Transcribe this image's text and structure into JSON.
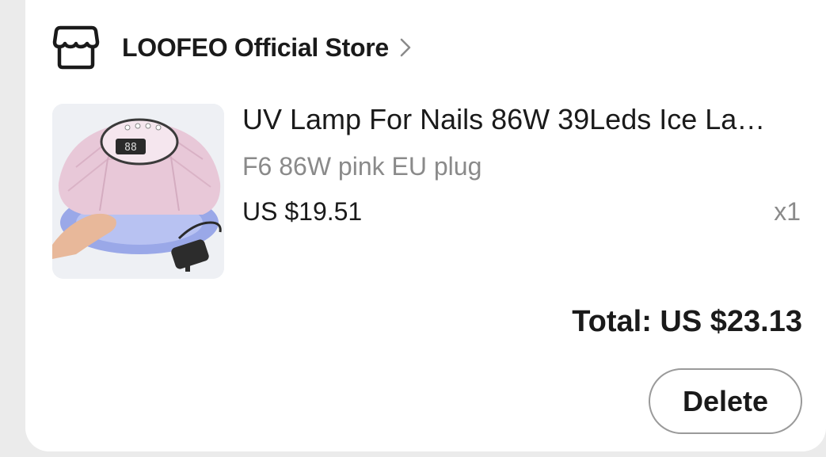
{
  "store": {
    "name": "LOOFEO Official Store",
    "icon": "store-icon",
    "chevron_icon": "chevron-right-icon"
  },
  "product": {
    "title": "UV Lamp For Nails 86W 39Leds Ice La…",
    "variant": "F6 86W pink EU plug",
    "price": "US $19.51",
    "quantity": "x1",
    "thumbnail_digits": "88"
  },
  "order": {
    "total": "Total: US $23.13"
  },
  "actions": {
    "delete_label": "Delete"
  },
  "colors": {
    "text_primary": "#1a1a1a",
    "text_secondary": "#8a8a8a",
    "lamp_pink": "#e8c8d8",
    "button_border": "#9a9a9a"
  }
}
